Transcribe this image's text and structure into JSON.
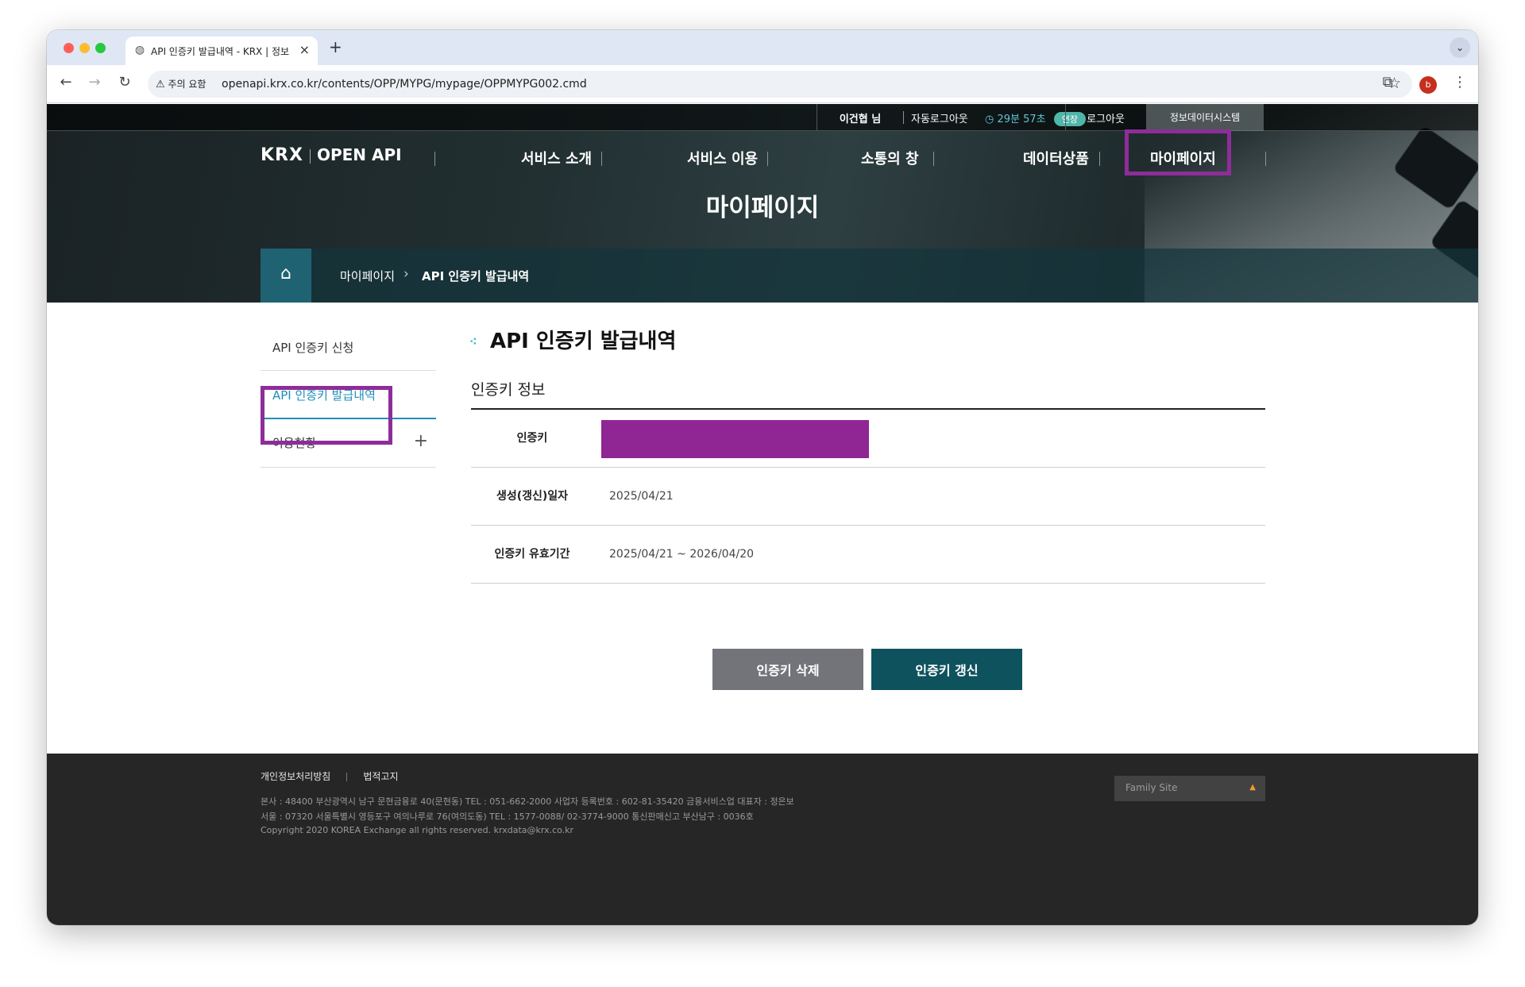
{
  "browser": {
    "tab_title": "API 인증키 발급내역 - KRX | 정보",
    "close_glyph": "×",
    "new_tab_glyph": "+",
    "address_warning": "주의 요함",
    "url": "openapi.krx.co.kr/contents/OPP/MYPG/mypage/OPPMYPG002.cmd",
    "profile_initial": "b"
  },
  "topbar": {
    "user": "이건협 님",
    "auto_logout_label": "자동로그아웃",
    "timer": "29분 57초",
    "extend": "연장",
    "logout": "로그아웃",
    "data_system": "정보데이터시스템"
  },
  "logo": {
    "brand": "KRX",
    "product": "OPEN API"
  },
  "gnb": {
    "items": [
      "서비스 소개",
      "서비스 이용",
      "소통의 창",
      "데이터상품",
      "마이페이지"
    ]
  },
  "hero": {
    "title": "마이페이지"
  },
  "breadcrumb": {
    "items": [
      "마이페이지",
      "API 인증키 발급내역"
    ]
  },
  "lnb": {
    "items": [
      "API 인증키 신청",
      "API 인증키 발급내역",
      "이용현황"
    ],
    "plus_glyph": "+"
  },
  "content": {
    "title": "API 인증키 발급내역",
    "section_title": "인증키 정보",
    "rows": [
      {
        "label": "인증키",
        "value": ""
      },
      {
        "label": "생성(갱신)일자",
        "value": "2025/04/21"
      },
      {
        "label": "인증키 유효기간",
        "value": "2025/04/21 ~ 2026/04/20"
      }
    ],
    "delete_button": "인증키 삭제",
    "renew_button": "인증키 갱신"
  },
  "footer": {
    "links": [
      "개인정보처리방침",
      "법적고지"
    ],
    "lines": [
      "본사 : 48400 부산광역시 남구 문현금융로 40(문현동) TEL : 051-662-2000 사업자 등록번호 : 602-81-35420 금융서비스업 대표자 : 정은보",
      "서울 : 07320 서울특별시 영등포구 여의나루로 76(여의도동) TEL : 1577-0088/ 02-3774-9000 통신판매신고 부산남구 : 0036호",
      "Copyright 2020 KOREA Exchange all rights reserved. krxdata@krx.co.kr"
    ],
    "family_site": "Family Site"
  },
  "colors": {
    "accent_teal": "#0e525d",
    "highlight_purple": "#8e2d9a",
    "active_blue": "#1f8fb9"
  }
}
